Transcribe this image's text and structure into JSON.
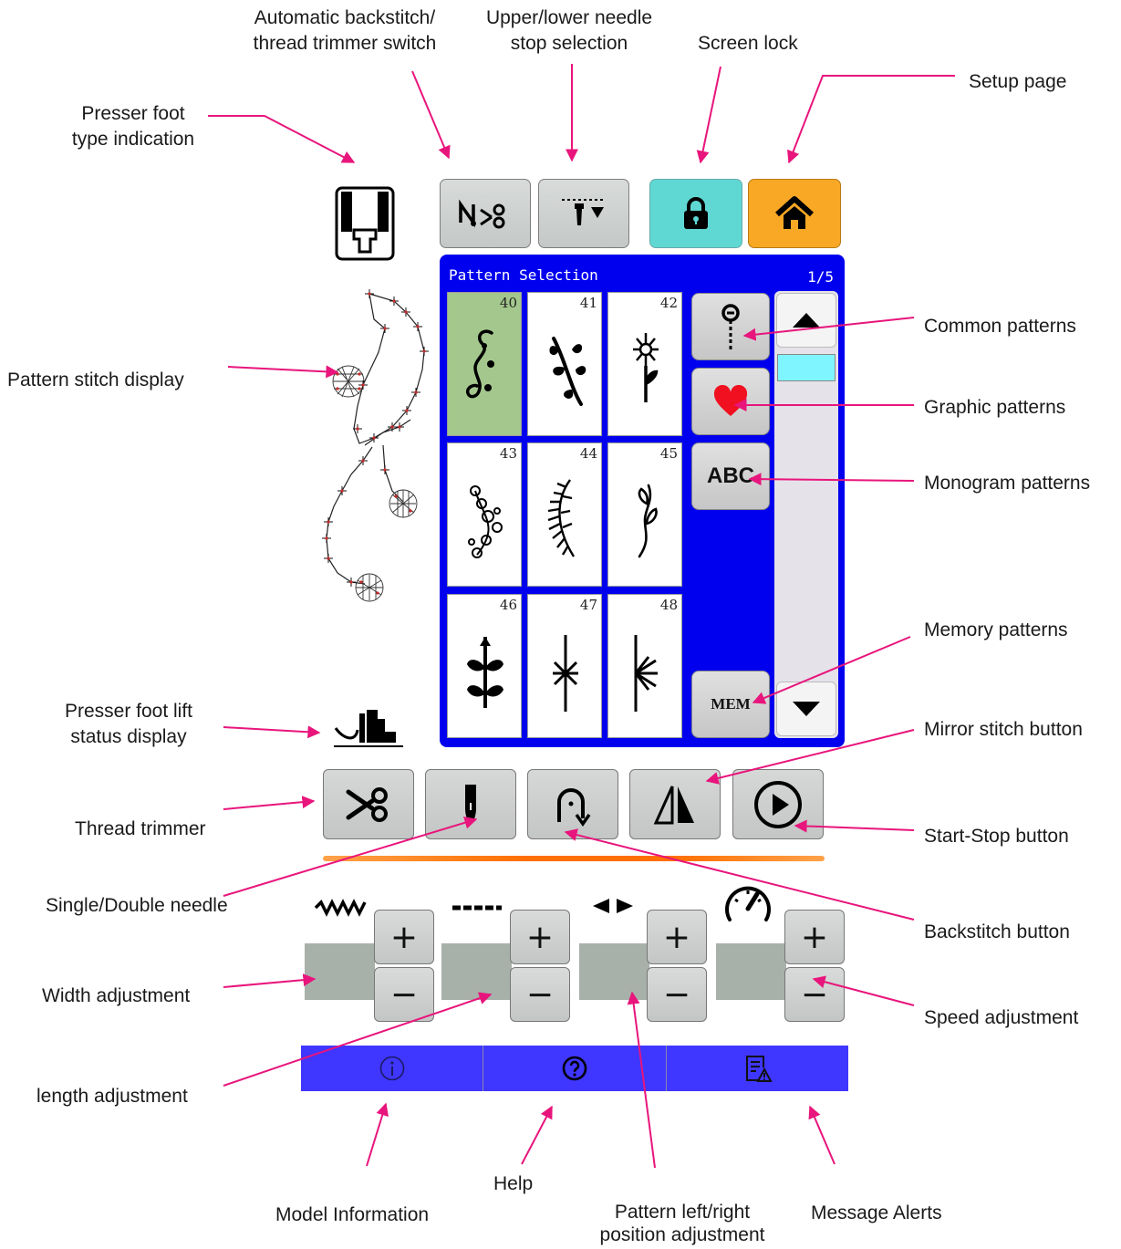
{
  "panel": {
    "title": "Pattern Selection",
    "page": "1/5",
    "patterns": [
      {
        "num": "40",
        "selected": true
      },
      {
        "num": "41",
        "selected": false
      },
      {
        "num": "42",
        "selected": false
      },
      {
        "num": "43",
        "selected": false
      },
      {
        "num": "44",
        "selected": false
      },
      {
        "num": "45",
        "selected": false
      },
      {
        "num": "46",
        "selected": false
      },
      {
        "num": "47",
        "selected": false
      },
      {
        "num": "48",
        "selected": false
      }
    ],
    "monogram_label": "ABC",
    "memory_label": "MEM"
  },
  "callouts": {
    "auto_backstitch_1": "Automatic backstitch/",
    "auto_backstitch_2": "thread trimmer switch",
    "needle_stop_1": "Upper/lower needle",
    "needle_stop_2": "stop selection",
    "screen_lock": "Screen lock",
    "setup_page": "Setup page",
    "presser_type_1": "Presser foot",
    "presser_type_2": "type indication",
    "pattern_stitch": "Pattern stitch display",
    "common": "Common patterns",
    "graphic": "Graphic patterns",
    "monogram": "Monogram patterns",
    "memory": "Memory patterns",
    "presser_lift_1": "Presser foot lift",
    "presser_lift_2": "status display",
    "mirror": "Mirror stitch button",
    "thread_trimmer": "Thread trimmer",
    "start_stop": "Start-Stop button",
    "single_double": "Single/Double needle",
    "backstitch": "Backstitch button",
    "width": "Width adjustment",
    "speed": "Speed adjustment",
    "length": "length adjustment",
    "model_info": "Model Information",
    "help": "Help",
    "position_1": "Pattern left/right",
    "position_2": "position adjustment",
    "message": "Message Alerts"
  },
  "adjust": {
    "plus": "+",
    "minus": "−"
  },
  "colors": {
    "panel": "#0000ee",
    "arrow": "#e8157c",
    "bottom_bar": "#3f36ff",
    "lock": "#5fd8d4",
    "home": "#f9a825",
    "selected": "#a3c78c"
  },
  "icons": [
    "presser-foot-icon",
    "backstitch-trim-icon",
    "needle-stop-icon",
    "lock-icon",
    "home-icon",
    "pin-icon",
    "heart-icon",
    "up-arrow-icon",
    "down-arrow-icon",
    "scissors-icon",
    "needle-icon",
    "backstitch-icon",
    "mirror-icon",
    "play-icon",
    "zigzag-icon",
    "dash-icon",
    "left-right-icon",
    "speedometer-icon",
    "info-icon",
    "help-icon",
    "alert-icon"
  ]
}
